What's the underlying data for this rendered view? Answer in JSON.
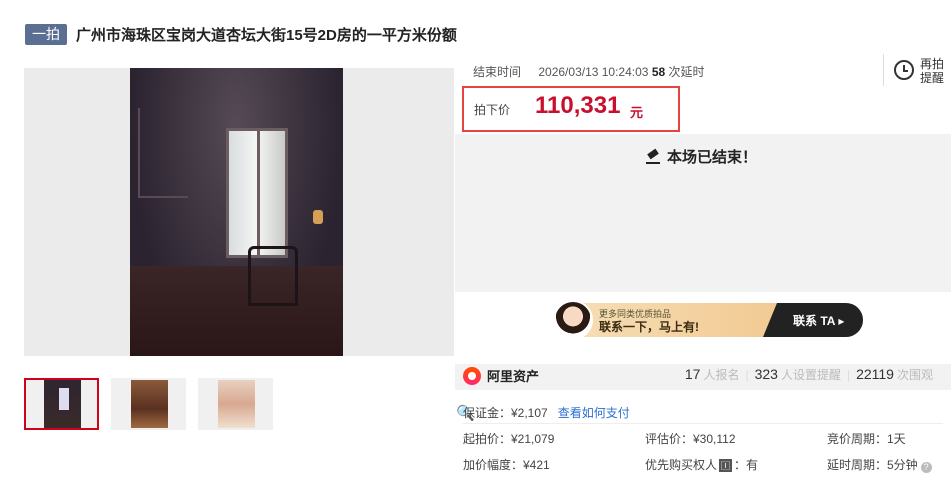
{
  "header": {
    "tag": "一拍",
    "title": "广州市海珠区宝岗大道杏坛大街15号2D房的一平方米份额"
  },
  "gallery": {
    "thumb_count": 3,
    "active_thumb": 1
  },
  "auction": {
    "end_label": "结束时间",
    "end_time": "2026/03/13 10:24:03",
    "delay_count": "58",
    "delay_suffix": "次延时",
    "remind_label": "再拍提醒",
    "price_label": "拍下价",
    "price": "110,331",
    "price_unit": "元",
    "ended_text": "本场已结束！"
  },
  "promo": {
    "small": "更多同类优质拍品",
    "big": "联系一下，马上有!",
    "cta": "联系 TA ▸"
  },
  "org": {
    "name": "阿里资产"
  },
  "stats": {
    "signups": "17",
    "signups_label": "人报名",
    "reminders": "323",
    "reminders_label": "人设置提醒",
    "views": "22119",
    "views_label": "次围观"
  },
  "details": {
    "deposit": "保证金：¥2,107",
    "deposit_link": "查看如何支付",
    "start_price": "起拍价：¥21,079",
    "appraisal": "评估价：¥30,112",
    "period": "竞价周期：1天",
    "increment": "加价幅度：¥421",
    "priority_label": "优先购买权人",
    "priority_badge": "🄸",
    "priority_value": "：有",
    "delay_period": "延时周期：5分钟"
  },
  "colors": {
    "accent_red": "#c8102e",
    "tag_bg": "#5b6f93",
    "link": "#2a6fd0"
  }
}
